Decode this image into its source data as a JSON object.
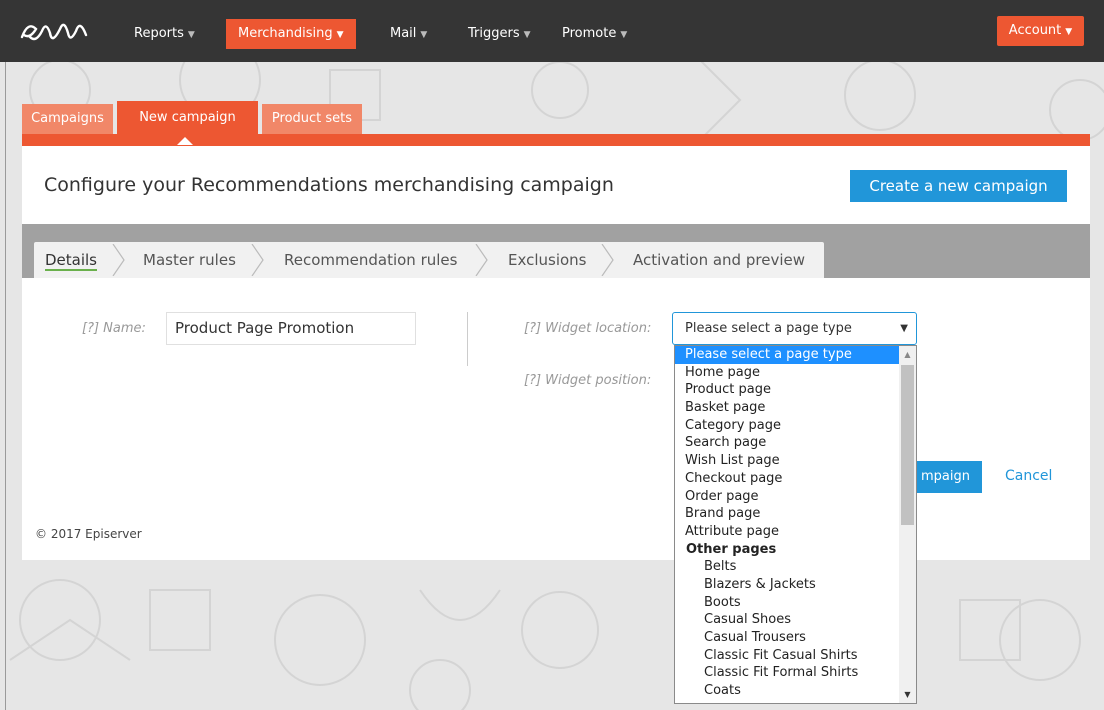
{
  "topnav": {
    "items": [
      {
        "label": "Reports"
      },
      {
        "label": "Merchandising"
      },
      {
        "label": "Mail"
      },
      {
        "label": "Triggers"
      },
      {
        "label": "Promote"
      }
    ],
    "account_label": "Account"
  },
  "subtabs": [
    {
      "label": "Campaigns"
    },
    {
      "label": "New campaign"
    },
    {
      "label": "Product sets"
    }
  ],
  "panel": {
    "title": "Configure your Recommendations merchandising campaign",
    "create_button": "Create a new campaign"
  },
  "steps": [
    {
      "label": "Details"
    },
    {
      "label": "Master rules"
    },
    {
      "label": "Recommendation rules"
    },
    {
      "label": "Exclusions"
    },
    {
      "label": "Activation and preview"
    }
  ],
  "form": {
    "name_label": "[?] Name:",
    "name_value": "Product Page Promotion",
    "widget_location_label": "[?] Widget location:",
    "widget_location_value": "Please select a page type",
    "widget_position_label": "[?] Widget position:",
    "save_button": "mpaign",
    "cancel_link": "Cancel"
  },
  "footer": "© 2017 Episerver",
  "dropdown": {
    "options": [
      "Please select a page type",
      "Home page",
      "Product page",
      "Basket page",
      "Category page",
      "Search page",
      "Wish List page",
      "Checkout page",
      "Order page",
      "Brand page",
      "Attribute page"
    ],
    "group_label": "Other pages",
    "group_options": [
      "Belts",
      "Blazers & Jackets",
      "Boots",
      "Casual Shoes",
      "Casual Trousers",
      "Classic Fit Casual Shirts",
      "Classic Fit Formal Shirts",
      "Coats"
    ]
  },
  "colors": {
    "brand_orange": "#ed5732",
    "primary_blue": "#2196d9",
    "topbar": "#353535"
  }
}
